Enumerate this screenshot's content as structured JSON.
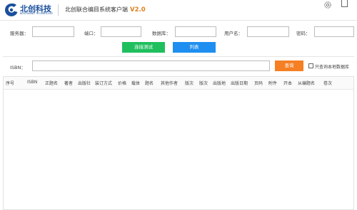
{
  "app": {
    "logo_text": "北创科技",
    "logo_subtext": "BEICHUANG TECHNOLOGY",
    "title": "北创联合编目系统客户端",
    "version": "V2.0"
  },
  "connection": {
    "server_label": "服务器：",
    "server_value": "",
    "port_label": "端口：",
    "port_value": "",
    "database_label": "数据库：",
    "database_value": "",
    "username_label": "用户名：",
    "username_value": "",
    "password_label": "密码：",
    "password_value": "",
    "test_button": "连接测试",
    "list_button": "列表"
  },
  "search": {
    "isbn_label": "ISBN：",
    "isbn_value": "",
    "query_button": "查询",
    "local_only_label": "只查询本地数据库",
    "local_only_checked": false
  },
  "table": {
    "columns": [
      "序号",
      "ISBN",
      "正题名",
      "著者",
      "出版社",
      "装订方式",
      "价格",
      "载体",
      "题名",
      "其他作者",
      "版次",
      "版次",
      "出版地",
      "出版日期",
      "页码",
      "附件",
      "开本",
      "从编题名",
      "卷次"
    ]
  },
  "colors": {
    "brand_blue": "#1a4f9c",
    "version_orange": "#e07f1c",
    "green_button": "#1fbf5e",
    "blue_button": "#1e8ff0",
    "orange_button": "#f57f22"
  }
}
